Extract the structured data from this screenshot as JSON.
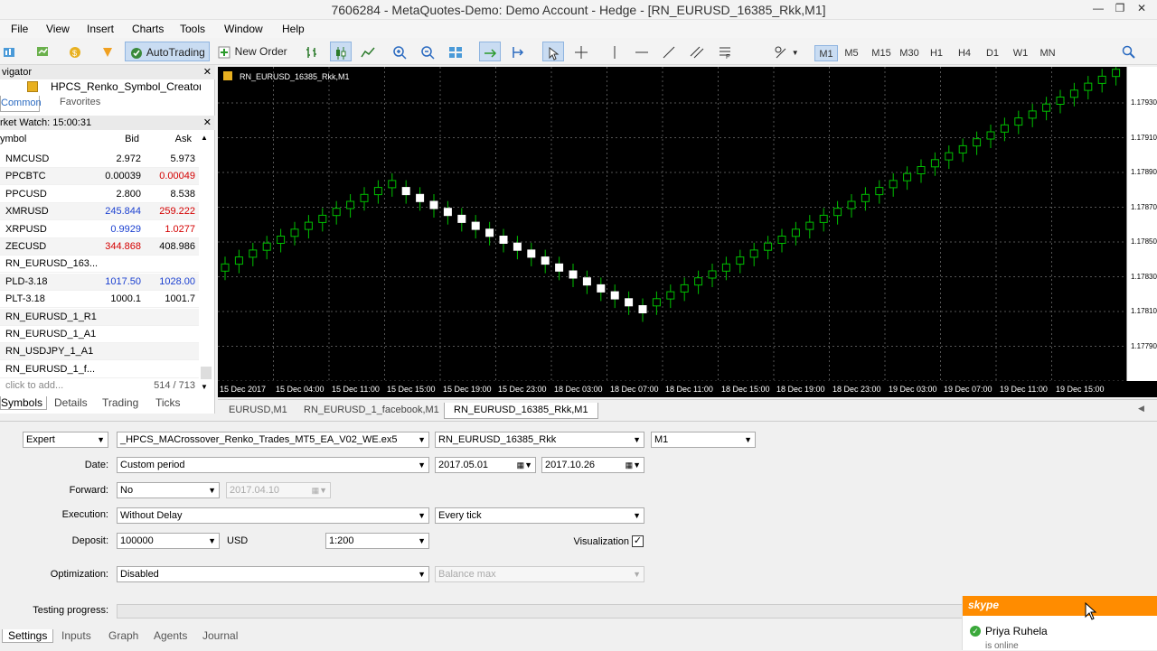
{
  "window": {
    "title": "7606284 - MetaQuotes-Demo: Demo Account - Hedge - [RN_EURUSD_16385_Rkk,M1]"
  },
  "menu": [
    "File",
    "View",
    "Insert",
    "Charts",
    "Tools",
    "Window",
    "Help"
  ],
  "toolbar": {
    "autotrading_label": "AutoTrading",
    "new_order_label": "New Order",
    "timeframes": [
      "M1",
      "M5",
      "M15",
      "M30",
      "H1",
      "H4",
      "D1",
      "W1",
      "MN"
    ],
    "active_timeframe": "M1"
  },
  "navigator": {
    "title": "vigator",
    "item": "HPCS_Renko_Symbol_Creator_M",
    "tabs": [
      "Common",
      "Favorites"
    ]
  },
  "market_watch": {
    "title": "rket Watch: 15:00:31",
    "columns": {
      "symbol": "ymbol",
      "bid": "Bid",
      "ask": "Ask"
    },
    "rows": [
      {
        "symbol": "NMCUSD",
        "bid": "2.972",
        "ask": "5.973",
        "bid_color": "#000000",
        "ask_color": "#000000"
      },
      {
        "symbol": "PPCBTC",
        "bid": "0.00039",
        "ask": "0.00049",
        "bid_color": "#000000",
        "ask_color": "#d40000"
      },
      {
        "symbol": "PPCUSD",
        "bid": "2.800",
        "ask": "8.538",
        "bid_color": "#000000",
        "ask_color": "#000000"
      },
      {
        "symbol": "XMRUSD",
        "bid": "245.844",
        "ask": "259.222",
        "bid_color": "#1a3fd0",
        "ask_color": "#d40000"
      },
      {
        "symbol": "XRPUSD",
        "bid": "0.9929",
        "ask": "1.0277",
        "bid_color": "#1a3fd0",
        "ask_color": "#d40000"
      },
      {
        "symbol": "ZECUSD",
        "bid": "344.868",
        "ask": "408.986",
        "bid_color": "#d40000",
        "ask_color": "#000000"
      },
      {
        "symbol": "RN_EURUSD_163...",
        "bid": "",
        "ask": "",
        "bid_color": "#000000",
        "ask_color": "#000000"
      },
      {
        "symbol": "PLD-3.18",
        "bid": "1017.50",
        "ask": "1028.00",
        "bid_color": "#1a3fd0",
        "ask_color": "#1a3fd0"
      },
      {
        "symbol": "PLT-3.18",
        "bid": "1000.1",
        "ask": "1001.7",
        "bid_color": "#000000",
        "ask_color": "#000000"
      },
      {
        "symbol": "RN_EURUSD_1_R1",
        "bid": "",
        "ask": "",
        "bid_color": "#000000",
        "ask_color": "#000000"
      },
      {
        "symbol": "RN_EURUSD_1_A1",
        "bid": "",
        "ask": "",
        "bid_color": "#000000",
        "ask_color": "#000000"
      },
      {
        "symbol": "RN_USDJPY_1_A1",
        "bid": "",
        "ask": "",
        "bid_color": "#000000",
        "ask_color": "#000000"
      },
      {
        "symbol": "RN_EURUSD_1_f...",
        "bid": "",
        "ask": "",
        "bid_color": "#000000",
        "ask_color": "#000000"
      }
    ],
    "footer_left": "click to add...",
    "footer_right": "514 / 713",
    "tabs": [
      "Symbols",
      "Details",
      "Trading",
      "Ticks"
    ]
  },
  "chart": {
    "label": "RN_EURUSD_16385_Rkk,M1",
    "price_ticks": [
      "1.17930",
      "1.17910",
      "1.17890",
      "1.17870",
      "1.17850",
      "1.17830",
      "1.17810",
      "1.17790"
    ],
    "time_ticks": [
      "15 Dec 2017",
      "15 Dec 04:00",
      "15 Dec 11:00",
      "15 Dec 15:00",
      "15 Dec 19:00",
      "15 Dec 23:00",
      "18 Dec 03:00",
      "18 Dec 07:00",
      "18 Dec 11:00",
      "18 Dec 15:00",
      "18 Dec 19:00",
      "18 Dec 23:00",
      "19 Dec 03:00",
      "19 Dec 07:00",
      "19 Dec 11:00",
      "19 Dec 15:00"
    ],
    "tabs": [
      "EURUSD,M1",
      "RN_EURUSD_1_facebook,M1",
      "RN_EURUSD_16385_Rkk,M1"
    ],
    "active_tab": 2
  },
  "tester": {
    "type": "Expert",
    "expert": "_HPCS_MACrossover_Renko_Trades_MT5_EA_V02_WE.ex5",
    "symbol": "RN_EURUSD_16385_Rkk",
    "timeframe": "M1",
    "date_label": "Date:",
    "date_mode": "Custom period",
    "date_from": "2017.05.01",
    "date_to": "2017.10.26",
    "forward_label": "Forward:",
    "forward": "No",
    "forward_date": "2017.04.10",
    "execution_label": "Execution:",
    "execution": "Without Delay",
    "tick_mode": "Every tick",
    "deposit_label": "Deposit:",
    "deposit": "100000",
    "currency": "USD",
    "leverage": "1:200",
    "visualization_label": "Visualization",
    "visualization_checked": true,
    "optimization_label": "Optimization:",
    "optimization": "Disabled",
    "criterion": "Balance max",
    "progress_label": "Testing progress:",
    "tabs": [
      "Settings",
      "Inputs",
      "Graph",
      "Agents",
      "Journal"
    ]
  },
  "skype": {
    "brand": "skype",
    "contact": "Priya Ruhela",
    "status": "is online"
  },
  "colors": {
    "chart_bg": "#000000",
    "bull_candle": "#ffffff",
    "wick": "#00c000",
    "skype_orange": "#ff8c00"
  }
}
